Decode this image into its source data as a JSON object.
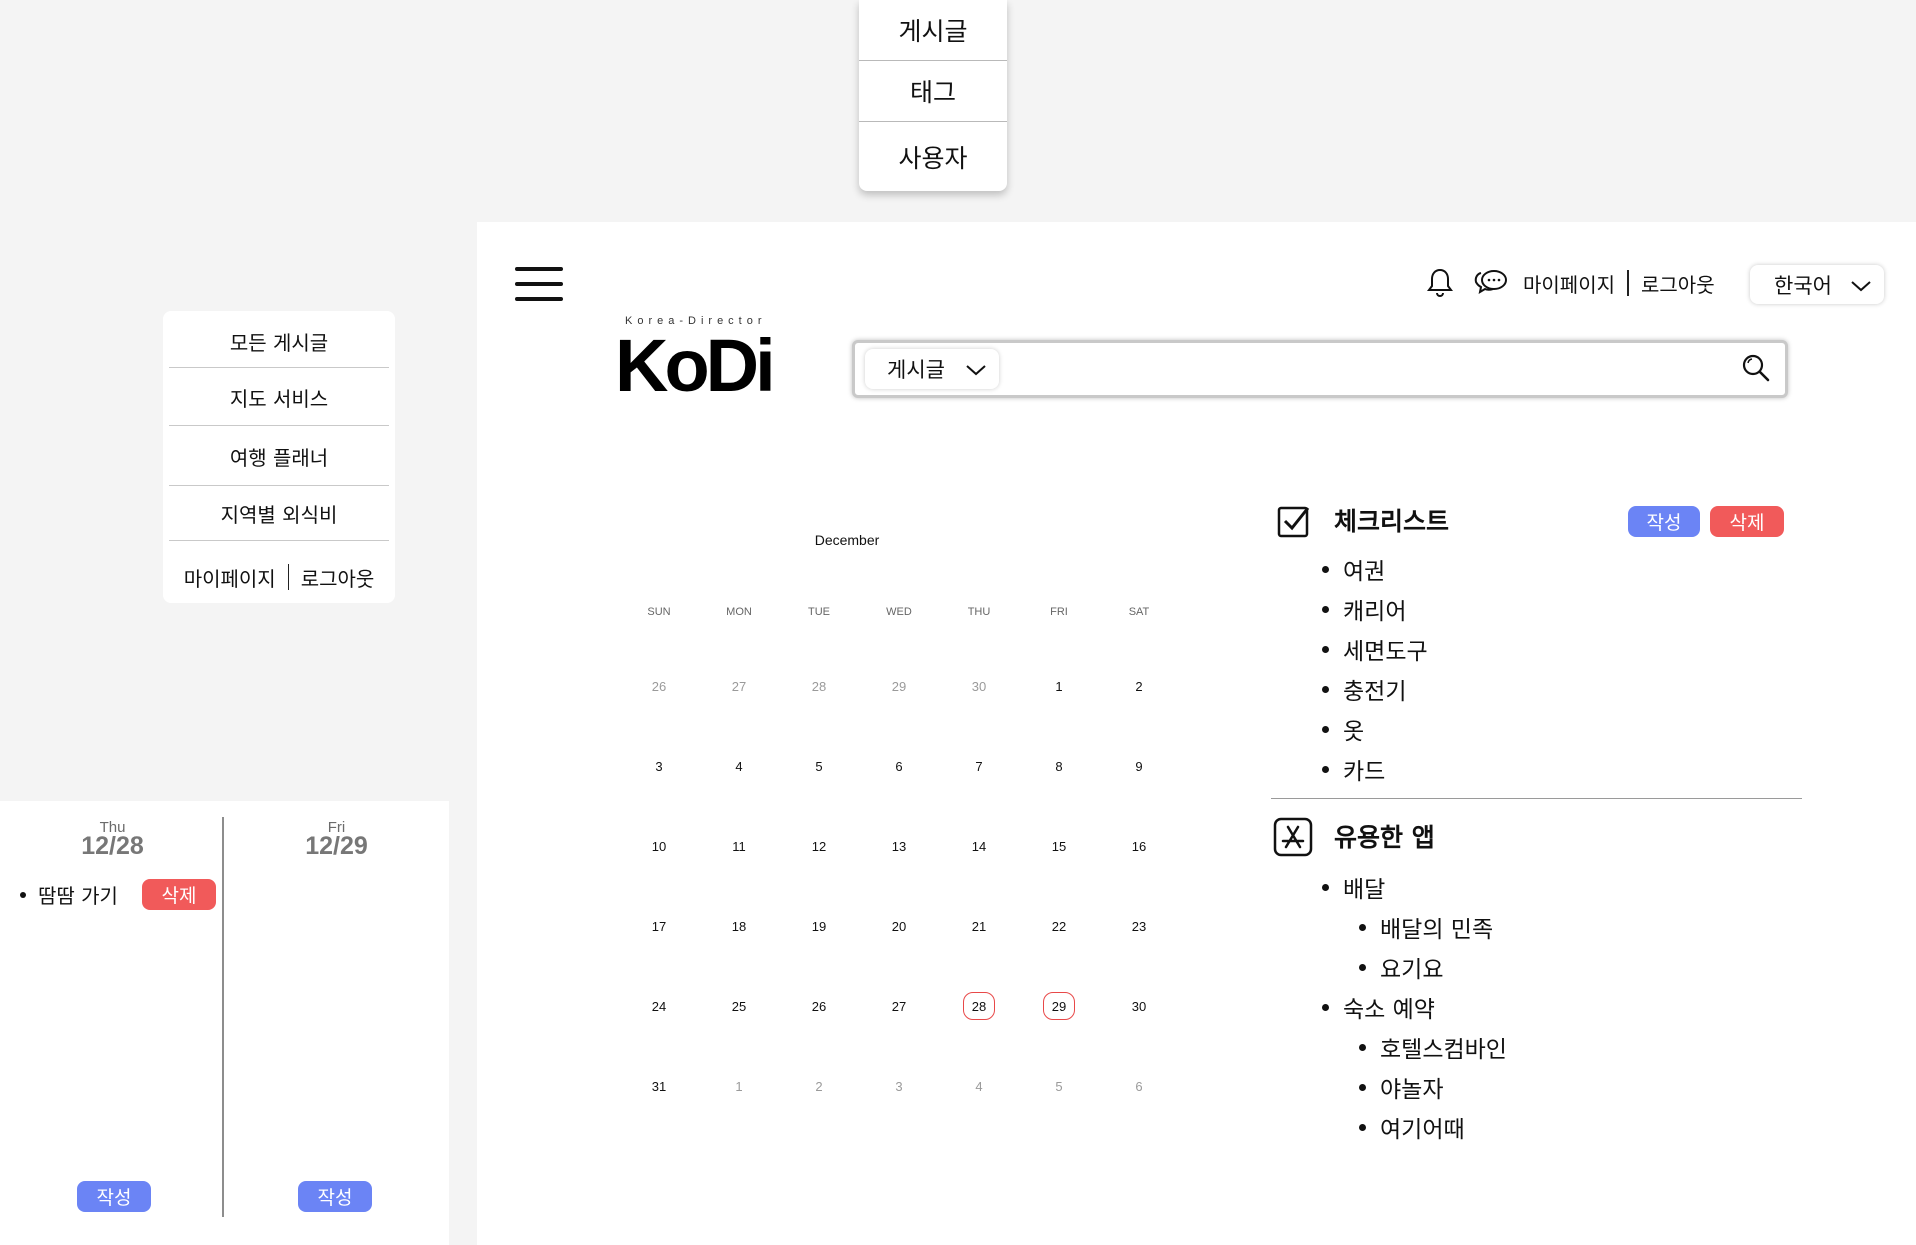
{
  "search_type_dropdown": {
    "options": [
      "게시글",
      "태그",
      "사용자"
    ]
  },
  "side_menu": {
    "items": [
      "모든 게시글",
      "지도 서비스",
      "여행 플래너",
      "지역별 외식비"
    ],
    "mypage": "마이페이지",
    "logout": "로그아웃"
  },
  "day_panel": {
    "days": [
      {
        "dow": "Thu",
        "date": "12/28",
        "write_label": "작성"
      },
      {
        "dow": "Fri",
        "date": "12/29",
        "write_label": "작성"
      }
    ],
    "todo": {
      "text": "땀땀 가기",
      "delete_label": "삭제"
    }
  },
  "header": {
    "logo_tagline": "Korea-Director",
    "logo_text": "KoDi",
    "mypage": "마이페이지",
    "logout": "로그아웃",
    "language": "한국어",
    "icons": [
      "bell-icon",
      "chat-icon",
      "chevron-down-icon",
      "search-icon",
      "hamburger-icon"
    ]
  },
  "search": {
    "type": "게시글",
    "placeholder": ""
  },
  "calendar": {
    "month": "December",
    "weekdays": [
      "SUN",
      "MON",
      "TUE",
      "WED",
      "THU",
      "FRI",
      "SAT"
    ],
    "weeks": [
      [
        "26",
        "27",
        "28",
        "29",
        "30",
        "1",
        "2"
      ],
      [
        "3",
        "4",
        "5",
        "6",
        "7",
        "8",
        "9"
      ],
      [
        "10",
        "11",
        "12",
        "13",
        "14",
        "15",
        "16"
      ],
      [
        "17",
        "18",
        "19",
        "20",
        "21",
        "22",
        "23"
      ],
      [
        "24",
        "25",
        "26",
        "27",
        "28",
        "29",
        "30"
      ],
      [
        "31",
        "1",
        "2",
        "3",
        "4",
        "5",
        "6"
      ]
    ],
    "marked_days": [
      "28",
      "29"
    ]
  },
  "checklist": {
    "title": "체크리스트",
    "write_label": "작성",
    "delete_label": "삭제",
    "items": [
      "여권",
      "캐리어",
      "세면도구",
      "충전기",
      "옷",
      "카드"
    ]
  },
  "useful_apps": {
    "title": "유용한 앱",
    "groups": [
      {
        "label": "배달",
        "children": [
          "배달의 민족",
          "요기요"
        ]
      },
      {
        "label": "숙소 예약",
        "children": [
          "호텔스컴바인",
          "야놀자",
          "여기어때"
        ]
      }
    ]
  },
  "colors": {
    "accent_blue": "#6b84f5",
    "danger_red": "#f15a5a",
    "marked_day": "#e84848"
  }
}
